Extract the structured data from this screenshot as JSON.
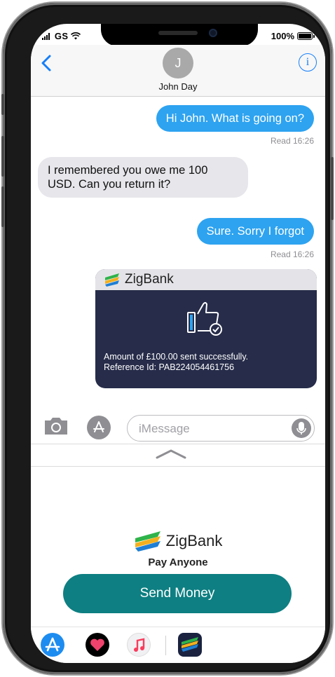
{
  "status": {
    "carrier": "GS",
    "battery": "100%"
  },
  "header": {
    "avatar_initial": "J",
    "contact": "John Day",
    "back_icon": "chevron-left-icon",
    "info_icon": "info-icon"
  },
  "messages": [
    {
      "direction": "outgoing",
      "text": "Hi John. What is going on?"
    },
    {
      "status": "Read 16:26"
    },
    {
      "direction": "incoming",
      "text": "I remembered you owe me 100 USD. Can you return it?"
    },
    {
      "direction": "outgoing",
      "text": "Sure. Sorry I forgot"
    },
    {
      "status": "Read 16:26"
    }
  ],
  "card": {
    "brand": "ZigBank",
    "line1": "Amount of £100.00 sent successfully.",
    "line2": "Reference Id: PAB224054461756"
  },
  "composer": {
    "placeholder": "iMessage"
  },
  "extension": {
    "brand": "ZigBank",
    "tagline": "Pay Anyone",
    "button": "Send Money"
  },
  "colors": {
    "outgoing": "#2ea3f0",
    "incoming": "#e6e6eb",
    "card_bg": "#262c49",
    "button": "#0e7f82",
    "link": "#147efb"
  }
}
